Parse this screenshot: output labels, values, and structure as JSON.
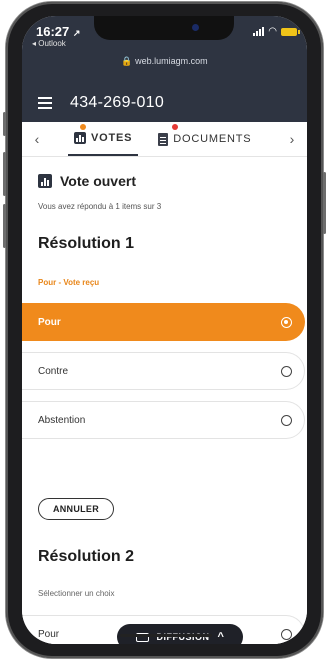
{
  "statusbar": {
    "time": "16:27",
    "time_arrow": "↗",
    "back_app": "◂ Outlook",
    "url": "web.lumiagm.com",
    "lock_icon": "lock-icon"
  },
  "header": {
    "meeting_id": "434-269-010"
  },
  "tabs": {
    "prev": "‹",
    "next": "›",
    "items": [
      {
        "label": "VOTES",
        "dot_color": "#f08a1c"
      },
      {
        "label": "DOCUMENTS",
        "dot_color": "#e53935"
      }
    ]
  },
  "main": {
    "section_title": "Vote ouvert",
    "progress": "Vous avez répondu à 1 items sur 3",
    "resolutions": [
      {
        "title": "Résolution 1",
        "status": "Pour - Vote reçu",
        "options": [
          "Pour",
          "Contre",
          "Abstention"
        ],
        "selected": "Pour",
        "cancel_label": "ANNULER"
      },
      {
        "title": "Résolution 2",
        "hint": "Sélectionner un choix",
        "options": [
          "Pour"
        ]
      }
    ]
  },
  "diffusion": {
    "label": "DIFFUSION",
    "chevron": "^"
  },
  "colors": {
    "header_bg": "#2e3441",
    "accent": "#f08a1c"
  }
}
